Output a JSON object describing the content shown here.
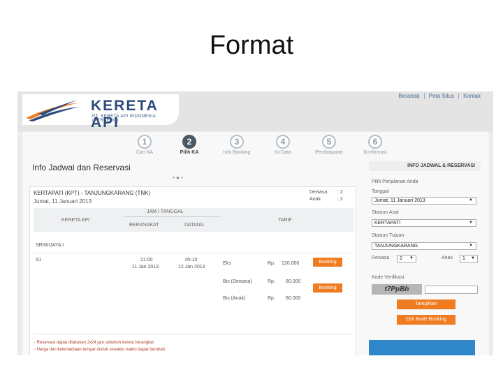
{
  "slide": {
    "title": "Format"
  },
  "header": {
    "logo_text": "KERETA API",
    "logo_sub": "PT. KERETA API INDONESIA (PERSERO)",
    "links": [
      "Beranda",
      "Peta Situs",
      "Kontak"
    ]
  },
  "steps": [
    {
      "num": "1",
      "label": "Cari KA",
      "active": false
    },
    {
      "num": "2",
      "label": "Pilih KA",
      "active": true
    },
    {
      "num": "3",
      "label": "Info Booking",
      "active": false
    },
    {
      "num": "4",
      "label": "Isi Data",
      "active": false
    },
    {
      "num": "5",
      "label": "Pembayaran",
      "active": false
    },
    {
      "num": "6",
      "label": "Konfirmasi",
      "active": false
    }
  ],
  "page": {
    "heading": "Info Jadwal dan Reservasi",
    "dots": "• ● •"
  },
  "schedule": {
    "route": "KERTAPATI (KPT) - TANJUNGKARANG (TNK)",
    "date": "Jumat, 11 Januari 2013",
    "adult_label": "Dewasa",
    "adult_value": ": 2",
    "child_label": "Anak",
    "child_value": ": 2",
    "headers": {
      "train": "KERETA API",
      "datetime": "JAM / TANGGAL",
      "depart": "BERANGKAT",
      "arrive": "DATANG",
      "fare": "TARIF"
    },
    "train_name": "SRIWIJAYA I",
    "train_no": "S1",
    "depart_time": "21:00",
    "depart_date": "11 Jan 2013",
    "arrive_time": "05:10",
    "arrive_date": "12 Jan 2013",
    "fares": [
      {
        "class": "Eks",
        "currency": "Rp.",
        "price": "120.000",
        "button": "Booking"
      },
      {
        "class": "Bis (Dewasa)",
        "currency": "Rp.",
        "price": "80.000",
        "button": "Booking"
      },
      {
        "class": "Bis (Anak)",
        "currency": "Rp.",
        "price": "80.000",
        "button": ""
      }
    ],
    "notes": [
      "- Reservasi dapat dilakukan 2x24 jam sebelum kereta berangkat",
      "- Harga dan ketersediaan tempat duduk sewaktu waktu dapat berubah"
    ]
  },
  "reservation_form": {
    "heading": "INFO JADWAL & RESERVASI",
    "trip_label": "Pilih Perjalanan Anda",
    "date_label": "Tanggal",
    "date_value": "Jumat, 11 Januari 2013",
    "origin_label": "Stasiun Asal",
    "origin_value": "KERTAPATI",
    "dest_label": "Stasiun Tujuan",
    "dest_value": "TANJUNGKARANG",
    "adult_label": "Dewasa",
    "adult_value": "2",
    "child_label": "Anak",
    "child_value": "1",
    "captcha_label": "Kode Verifikasi",
    "captcha_text": "t7PpBh",
    "show_button": "Tampilkan",
    "check_button": "Cek Kode Booking"
  }
}
